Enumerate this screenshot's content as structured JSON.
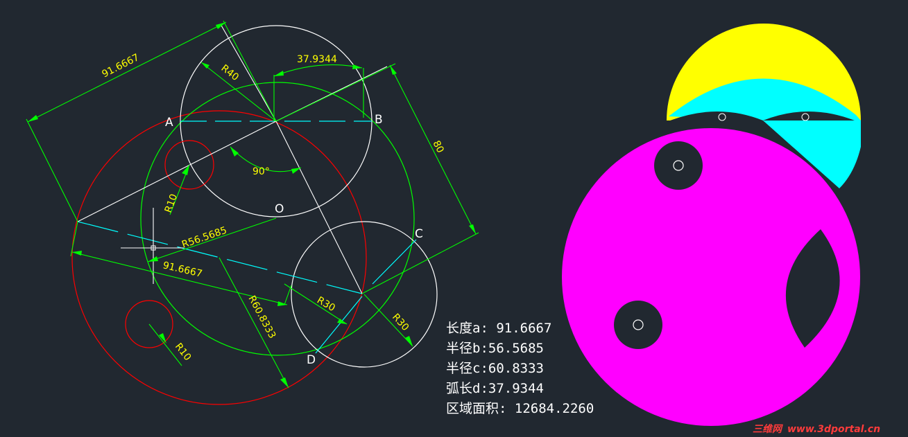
{
  "colors": {
    "background": "#212830",
    "white": "#ffffff",
    "red": "#ff0000",
    "green": "#00ff00",
    "cyan": "#00ffff",
    "yellow": "#ffff00",
    "magenta": "#ff00ff"
  },
  "point_labels": {
    "A": "A",
    "B": "B",
    "C": "C",
    "D": "D",
    "O": "O"
  },
  "dimensions": {
    "top_length": "91.6667",
    "r40": "R40",
    "arc_length": "37.9344",
    "height_80": "80",
    "angle": "90°",
    "r10_upper": "R10",
    "r56": "R56.5685",
    "bottom_length": "91.6667",
    "r60": "R60.8333",
    "r30_left": "R30",
    "r30_right": "R30",
    "r10_lower": "R10"
  },
  "results": {
    "line1": "长度a: 91.6667",
    "line2": "半径b:56.5685",
    "line3": "半径c:60.8333",
    "line4": "弧长d:37.9344",
    "line5": "区域面积: 12684.2260"
  },
  "watermark": {
    "prefix": "三维网",
    "url": "www.3dportal.cn"
  }
}
